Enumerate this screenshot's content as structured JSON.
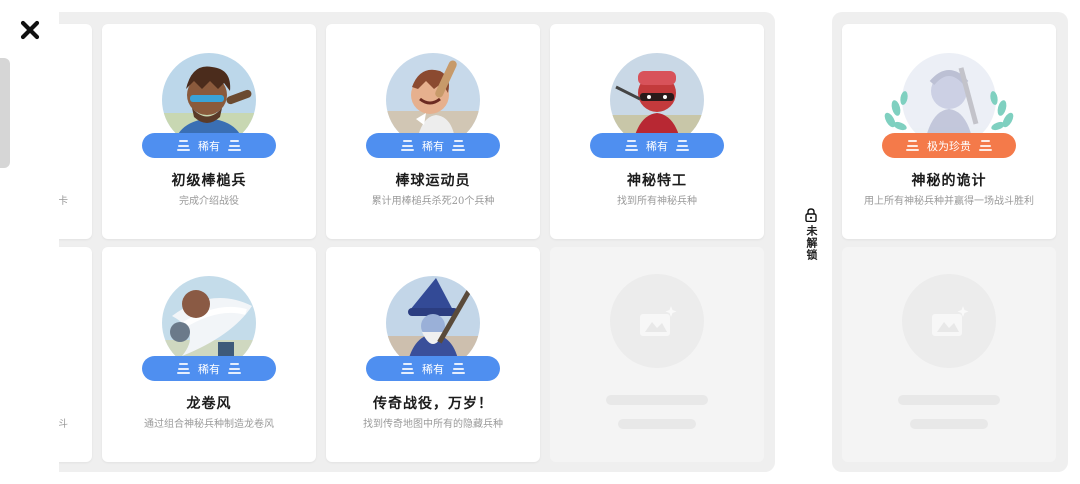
{
  "achievements": [
    {
      "title": "初级棒槌兵",
      "desc": "完成介绍战役",
      "rarity": "稀有"
    },
    {
      "title": "棒球运动员",
      "desc": "累计用棒槌兵杀死20个兵种",
      "rarity": "稀有"
    },
    {
      "title": "神秘特工",
      "desc": "找到所有神秘兵种",
      "rarity": "稀有"
    },
    {
      "title": "龙卷风",
      "desc": "通过组合神秘兵种制造龙卷风",
      "rarity": "稀有"
    },
    {
      "title": "传奇战役，万岁！",
      "desc": "找到传奇地图中所有的隐藏兵种",
      "rarity": "稀有"
    }
  ],
  "locked_section": {
    "label": "未解锁",
    "card": {
      "title": "神秘的诡计",
      "desc": "用上所有神秘兵种并赢得一场战斗胜利",
      "rarity": "极为珍贵"
    }
  },
  "partial_text": {
    "top": "卡",
    "bottom": "斗"
  },
  "colors": {
    "rare": "#4f8ff0",
    "precious": "#f47a4a",
    "panel_bg": "#efefef"
  },
  "icons": {
    "close": "close-icon",
    "lock": "lock-icon",
    "placeholder": "image-placeholder-icon"
  }
}
